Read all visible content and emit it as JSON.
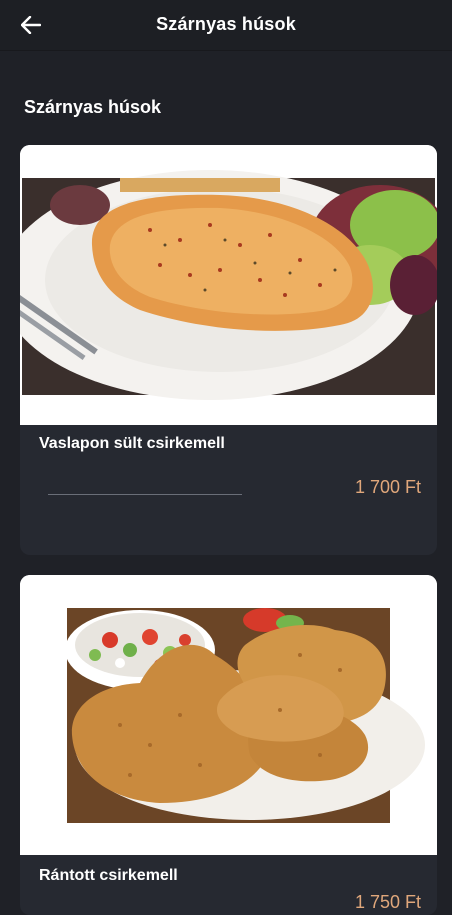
{
  "appbar": {
    "title": "Szárnyas húsok",
    "back_icon": "arrow-left-icon"
  },
  "section": {
    "title": "Szárnyas húsok"
  },
  "items": [
    {
      "name": "Vaslapon sült csirkemell",
      "price": "1 700 Ft",
      "image": "grilled chicken breast with salad"
    },
    {
      "name": "Rántott csirkemell",
      "price": "1 750 Ft",
      "image": "breaded chicken breast with salad"
    }
  ],
  "colors": {
    "background": "#1f2127",
    "card": "#262931",
    "price": "#e0a77b"
  }
}
